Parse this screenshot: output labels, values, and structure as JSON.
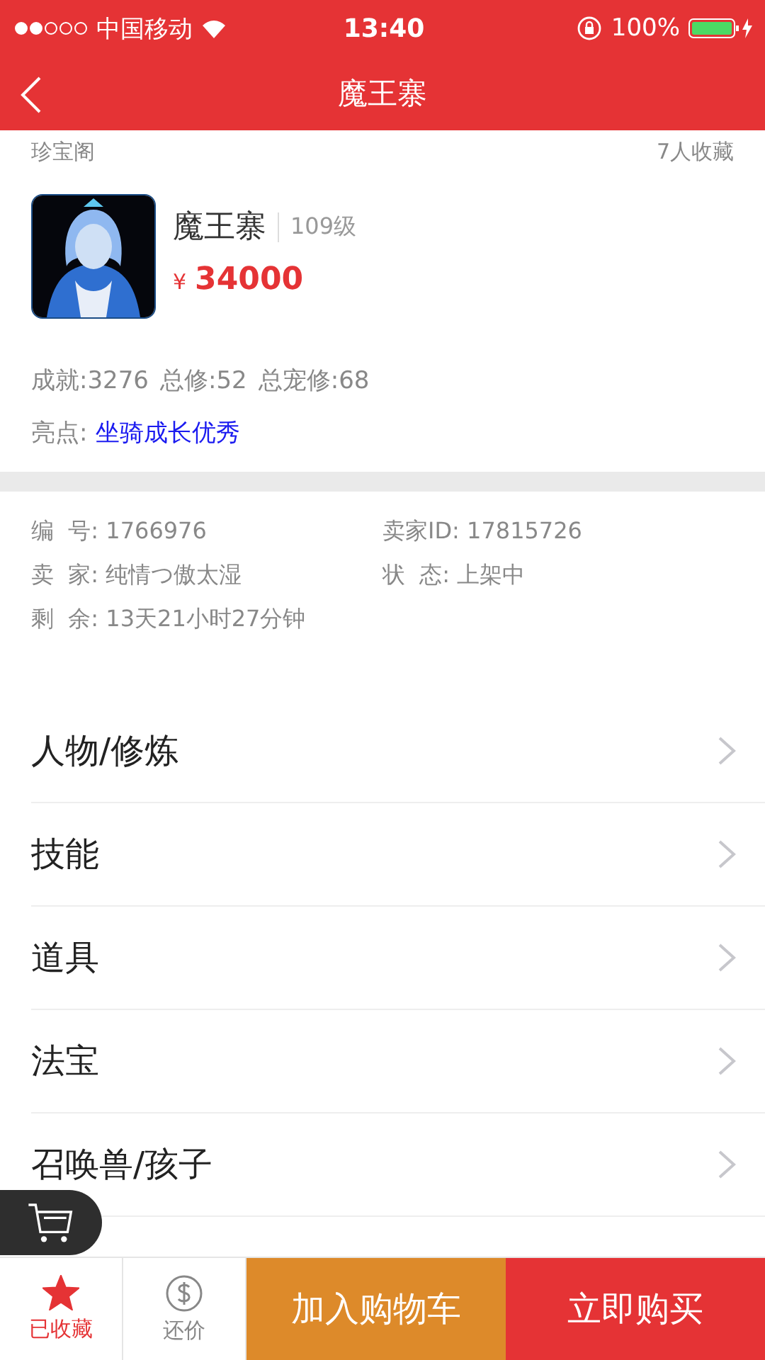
{
  "status_bar": {
    "carrier": "中国移动",
    "time": "13:40",
    "battery": "100%"
  },
  "nav": {
    "title": "魔王寨"
  },
  "header": {
    "source": "珍宝阁",
    "favorites": "7人收藏"
  },
  "item": {
    "name": "魔王寨",
    "level": "109级",
    "currency": "¥",
    "price": "34000",
    "stats": [
      "成就:3276",
      "总修:52",
      "总宠修:68"
    ],
    "highlight_label": "亮点:",
    "highlight": "坐骑成长优秀"
  },
  "info": [
    {
      "label": "编  号:",
      "value": "1766976"
    },
    {
      "label": "卖家ID:",
      "value": "17815726"
    },
    {
      "label": "卖  家:",
      "value": "纯情つ傲太湿"
    },
    {
      "label": "状  态:",
      "value": "上架中"
    },
    {
      "label": "剩  余:",
      "value": "13天21小时27分钟"
    }
  ],
  "menu": [
    {
      "label": "人物/修炼"
    },
    {
      "label": "技能"
    },
    {
      "label": "道具"
    },
    {
      "label": "法宝"
    },
    {
      "label": "召唤兽/孩子"
    }
  ],
  "bottom_bar": {
    "favorite": {
      "label": "已收藏",
      "selected": true
    },
    "bargain": {
      "label": "还价"
    },
    "add_to_cart": "加入购物车",
    "buy_now": "立即购买"
  }
}
